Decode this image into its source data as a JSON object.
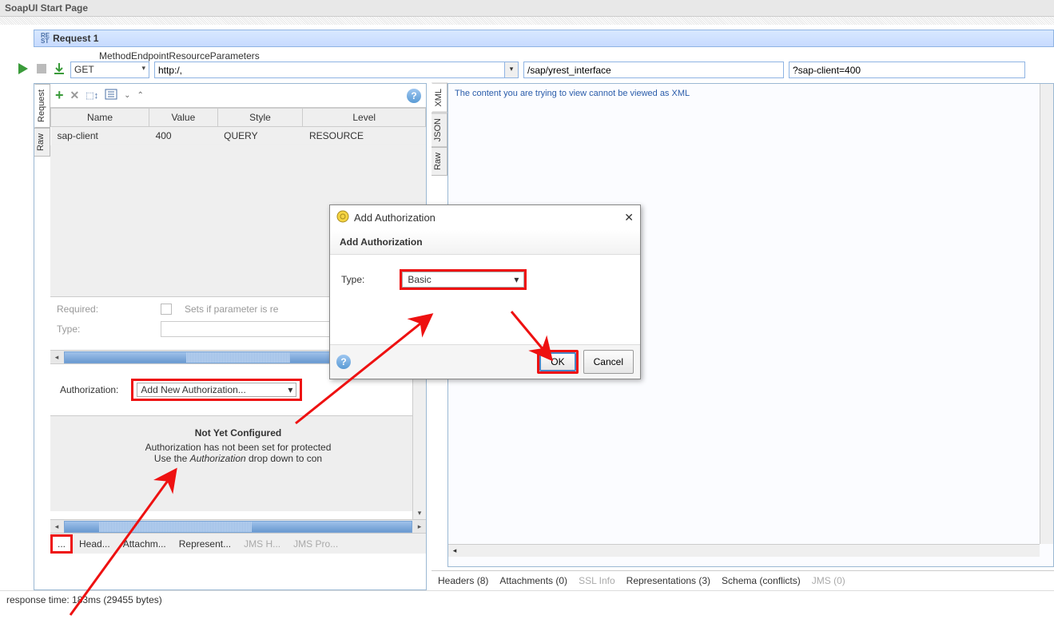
{
  "tabs": {
    "start_page": "SoapUI Start Page",
    "request": "Request 1",
    "rest_badge": "RE\nST"
  },
  "method_row": {
    "labels": {
      "method": "Method",
      "endpoint": "Endpoint",
      "resource": "Resource",
      "parameters": "Parameters"
    },
    "values": {
      "method": "GET",
      "endpoint": "http:/,",
      "resource": "/sap/yrest_interface",
      "parameters": "?sap-client=400"
    }
  },
  "side_tabs_left": {
    "raw": "Raw",
    "request": "Request"
  },
  "side_tabs_right": {
    "raw": "Raw",
    "json": "JSON",
    "xml": "XML"
  },
  "params_table": {
    "headers": {
      "name": "Name",
      "value": "Value",
      "style": "Style",
      "level": "Level"
    },
    "rows": [
      {
        "name": "sap-client",
        "value": "400",
        "style": "QUERY",
        "level": "RESOURCE"
      }
    ]
  },
  "detail": {
    "required": "Required:",
    "checkbox_label": "Sets if parameter is re",
    "type": "Type:"
  },
  "auth": {
    "label": "Authorization:",
    "combo": "Add New Authorization...",
    "not_configured_title": "Not Yet Configured",
    "not_configured_line1": "Authorization has not been set for protected",
    "not_configured_line2_a": "Use the ",
    "not_configured_line2_em": "Authorization",
    "not_configured_line2_b": " drop down to con"
  },
  "bottom_tabs_left": {
    "active": "...",
    "headers": "Head...",
    "attachments": "Attachm...",
    "representations": "Represent...",
    "jms_headers": "JMS H...",
    "jms_properties": "JMS Pro..."
  },
  "bottom_tabs_right": {
    "headers": "Headers (8)",
    "attachments": "Attachments (0)",
    "ssl": "SSL Info",
    "representations": "Representations (3)",
    "schema": "Schema (conflicts)",
    "jms": "JMS (0)"
  },
  "xml_warning": "The content you are trying to view cannot be viewed as XML",
  "status_bar": "response time: 183ms (29455 bytes)",
  "dialog": {
    "window_title": "Add Authorization",
    "header": "Add Authorization",
    "type_label": "Type:",
    "type_value": "Basic",
    "ok": "OK",
    "cancel": "Cancel"
  },
  "icons": {
    "plus": "+",
    "x": "✕",
    "arrow_down": "▾",
    "arrow_left": "◂",
    "arrow_right": "▸",
    "arrow_up": "▴",
    "help": "?",
    "close": "✕"
  }
}
